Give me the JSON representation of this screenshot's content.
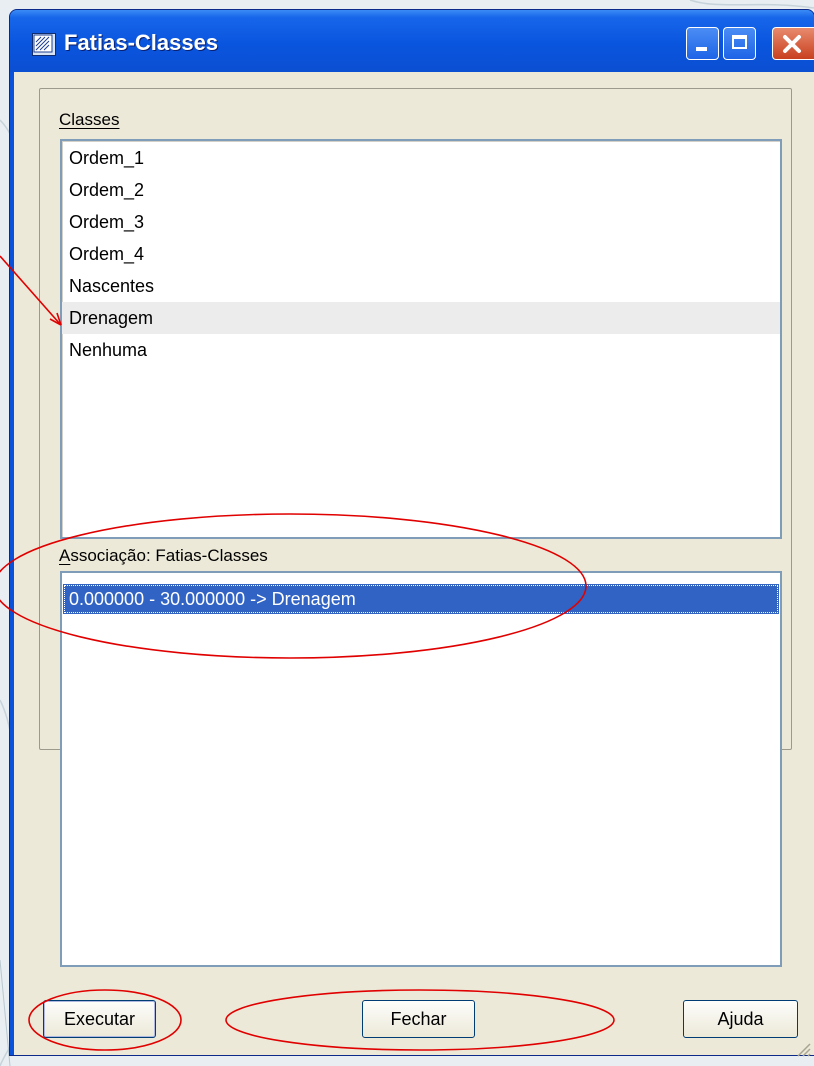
{
  "window": {
    "title": "Fatias-Classes"
  },
  "classes": {
    "label": "Classes",
    "items": [
      "Ordem_1",
      "Ordem_2",
      "Ordem_3",
      "Ordem_4",
      "Nascentes",
      "Drenagem",
      "Nenhuma"
    ],
    "hovered": "Drenagem"
  },
  "association": {
    "label": "Associação: Fatias-Classes",
    "items": [
      "0.000000 - 30.000000 -> Drenagem"
    ]
  },
  "buttons": {
    "execute": "Executar",
    "close": "Fechar",
    "help": "Ajuda"
  },
  "colors": {
    "title_bar": "#0a55de",
    "selection": "#3163c5",
    "annotation": "#e00000",
    "dialog_face": "#ece9d8"
  }
}
